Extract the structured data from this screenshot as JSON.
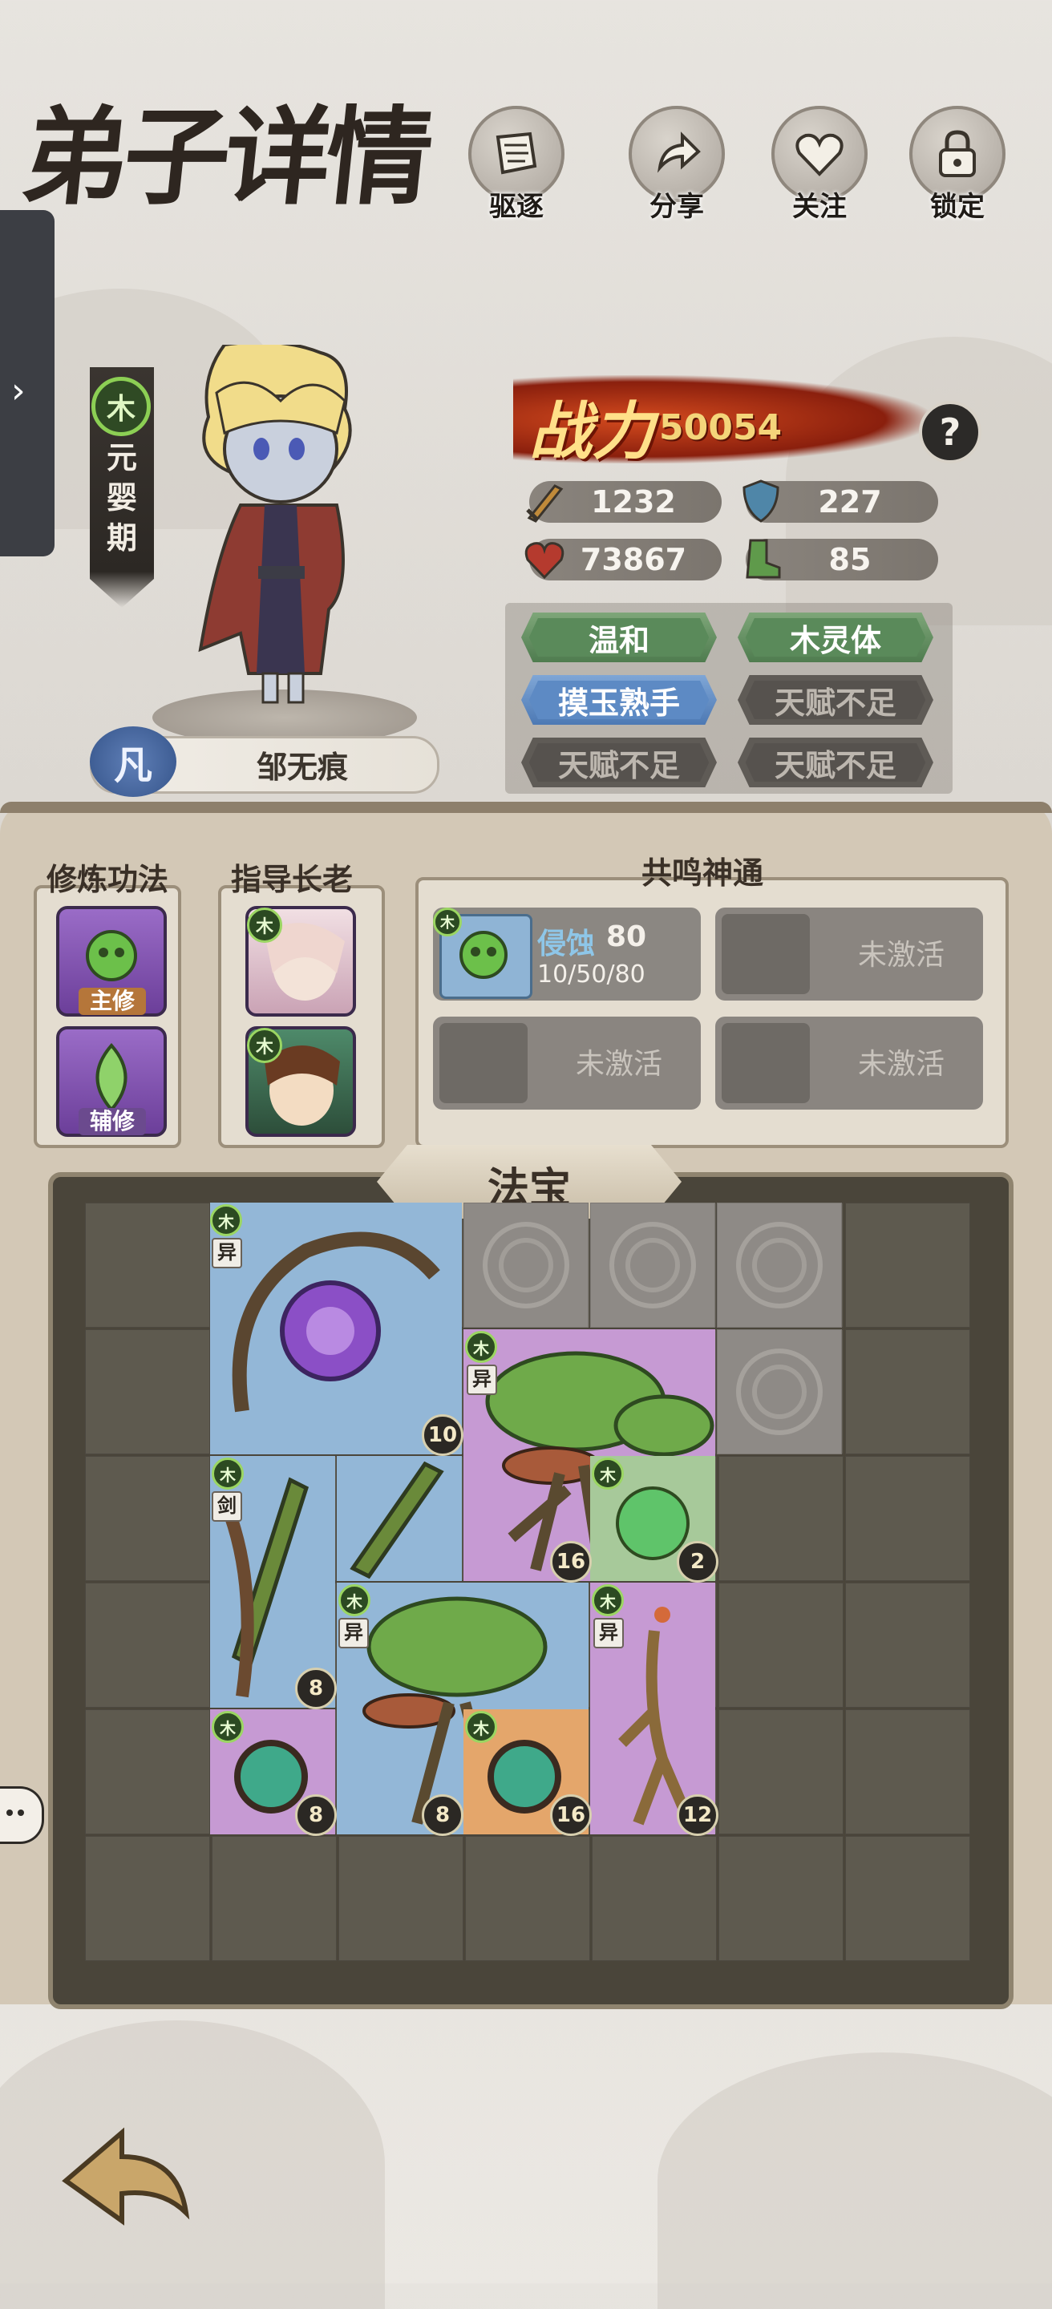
{
  "header": {
    "title": "弟子详情",
    "buttons": [
      {
        "label": "驱逐",
        "icon": "scroll-icon"
      },
      {
        "label": "分享",
        "icon": "share-arrow-icon"
      },
      {
        "label": "关注",
        "icon": "heart-icon"
      },
      {
        "label": "锁定",
        "icon": "lock-icon"
      }
    ]
  },
  "character": {
    "element": "木",
    "realm": [
      "元",
      "婴",
      "期"
    ],
    "rank": "凡",
    "name": "邹无痕"
  },
  "power": {
    "label": "战力",
    "value": "50054",
    "help": "?"
  },
  "stats": [
    {
      "icon": "sword-icon",
      "value": "1232",
      "color": "#c08a3a"
    },
    {
      "icon": "shield-icon",
      "value": "227",
      "color": "#4f86a8"
    },
    {
      "icon": "heart-icon",
      "value": "73867",
      "color": "#b53a2e"
    },
    {
      "icon": "boot-icon",
      "value": "85",
      "color": "#5f9a4b"
    }
  ],
  "traits": [
    {
      "label": "温和",
      "style": "green"
    },
    {
      "label": "木灵体",
      "style": "green"
    },
    {
      "label": "摸玉熟手",
      "style": "blue"
    },
    {
      "label": "天赋不足",
      "style": "gray"
    },
    {
      "label": "天赋不足",
      "style": "gray"
    },
    {
      "label": "天赋不足",
      "style": "gray"
    }
  ],
  "cultivation": {
    "title": "修炼功法",
    "main_tag": "主修",
    "aux_tag": "辅修"
  },
  "elders": {
    "title": "指导长老",
    "badge": "木"
  },
  "resonance": {
    "title": "共鸣神通",
    "active": {
      "name": "侵蚀",
      "level": "80",
      "progress": "10/50/80",
      "badge": "木"
    },
    "inactive_label": "未激活"
  },
  "treasure": {
    "title": "法宝",
    "items": [
      {
        "name": "purple-lotus-vine",
        "badge": "木",
        "tag": "异",
        "level": "10",
        "color": "blue"
      },
      {
        "name": "mushroom-tree-top",
        "badge": "木",
        "tag": "异",
        "level": "16",
        "color": "purple"
      },
      {
        "name": "green-orb",
        "badge": "木",
        "tag": "",
        "level": "2",
        "color": "green"
      },
      {
        "name": "vine-sword",
        "badge": "木",
        "tag": "剑",
        "level": "8",
        "color": "blue"
      },
      {
        "name": "mushroom-tree-bottom",
        "badge": "木",
        "tag": "异",
        "level": "8",
        "color": "blue"
      },
      {
        "name": "ginseng-root",
        "badge": "木",
        "tag": "异",
        "level": "12",
        "color": "purple"
      },
      {
        "name": "thorn-orb-purple",
        "badge": "木",
        "tag": "",
        "level": "8",
        "color": "purple"
      },
      {
        "name": "thorn-orb-orange",
        "badge": "木",
        "tag": "",
        "level": "16",
        "color": "orange"
      }
    ]
  }
}
